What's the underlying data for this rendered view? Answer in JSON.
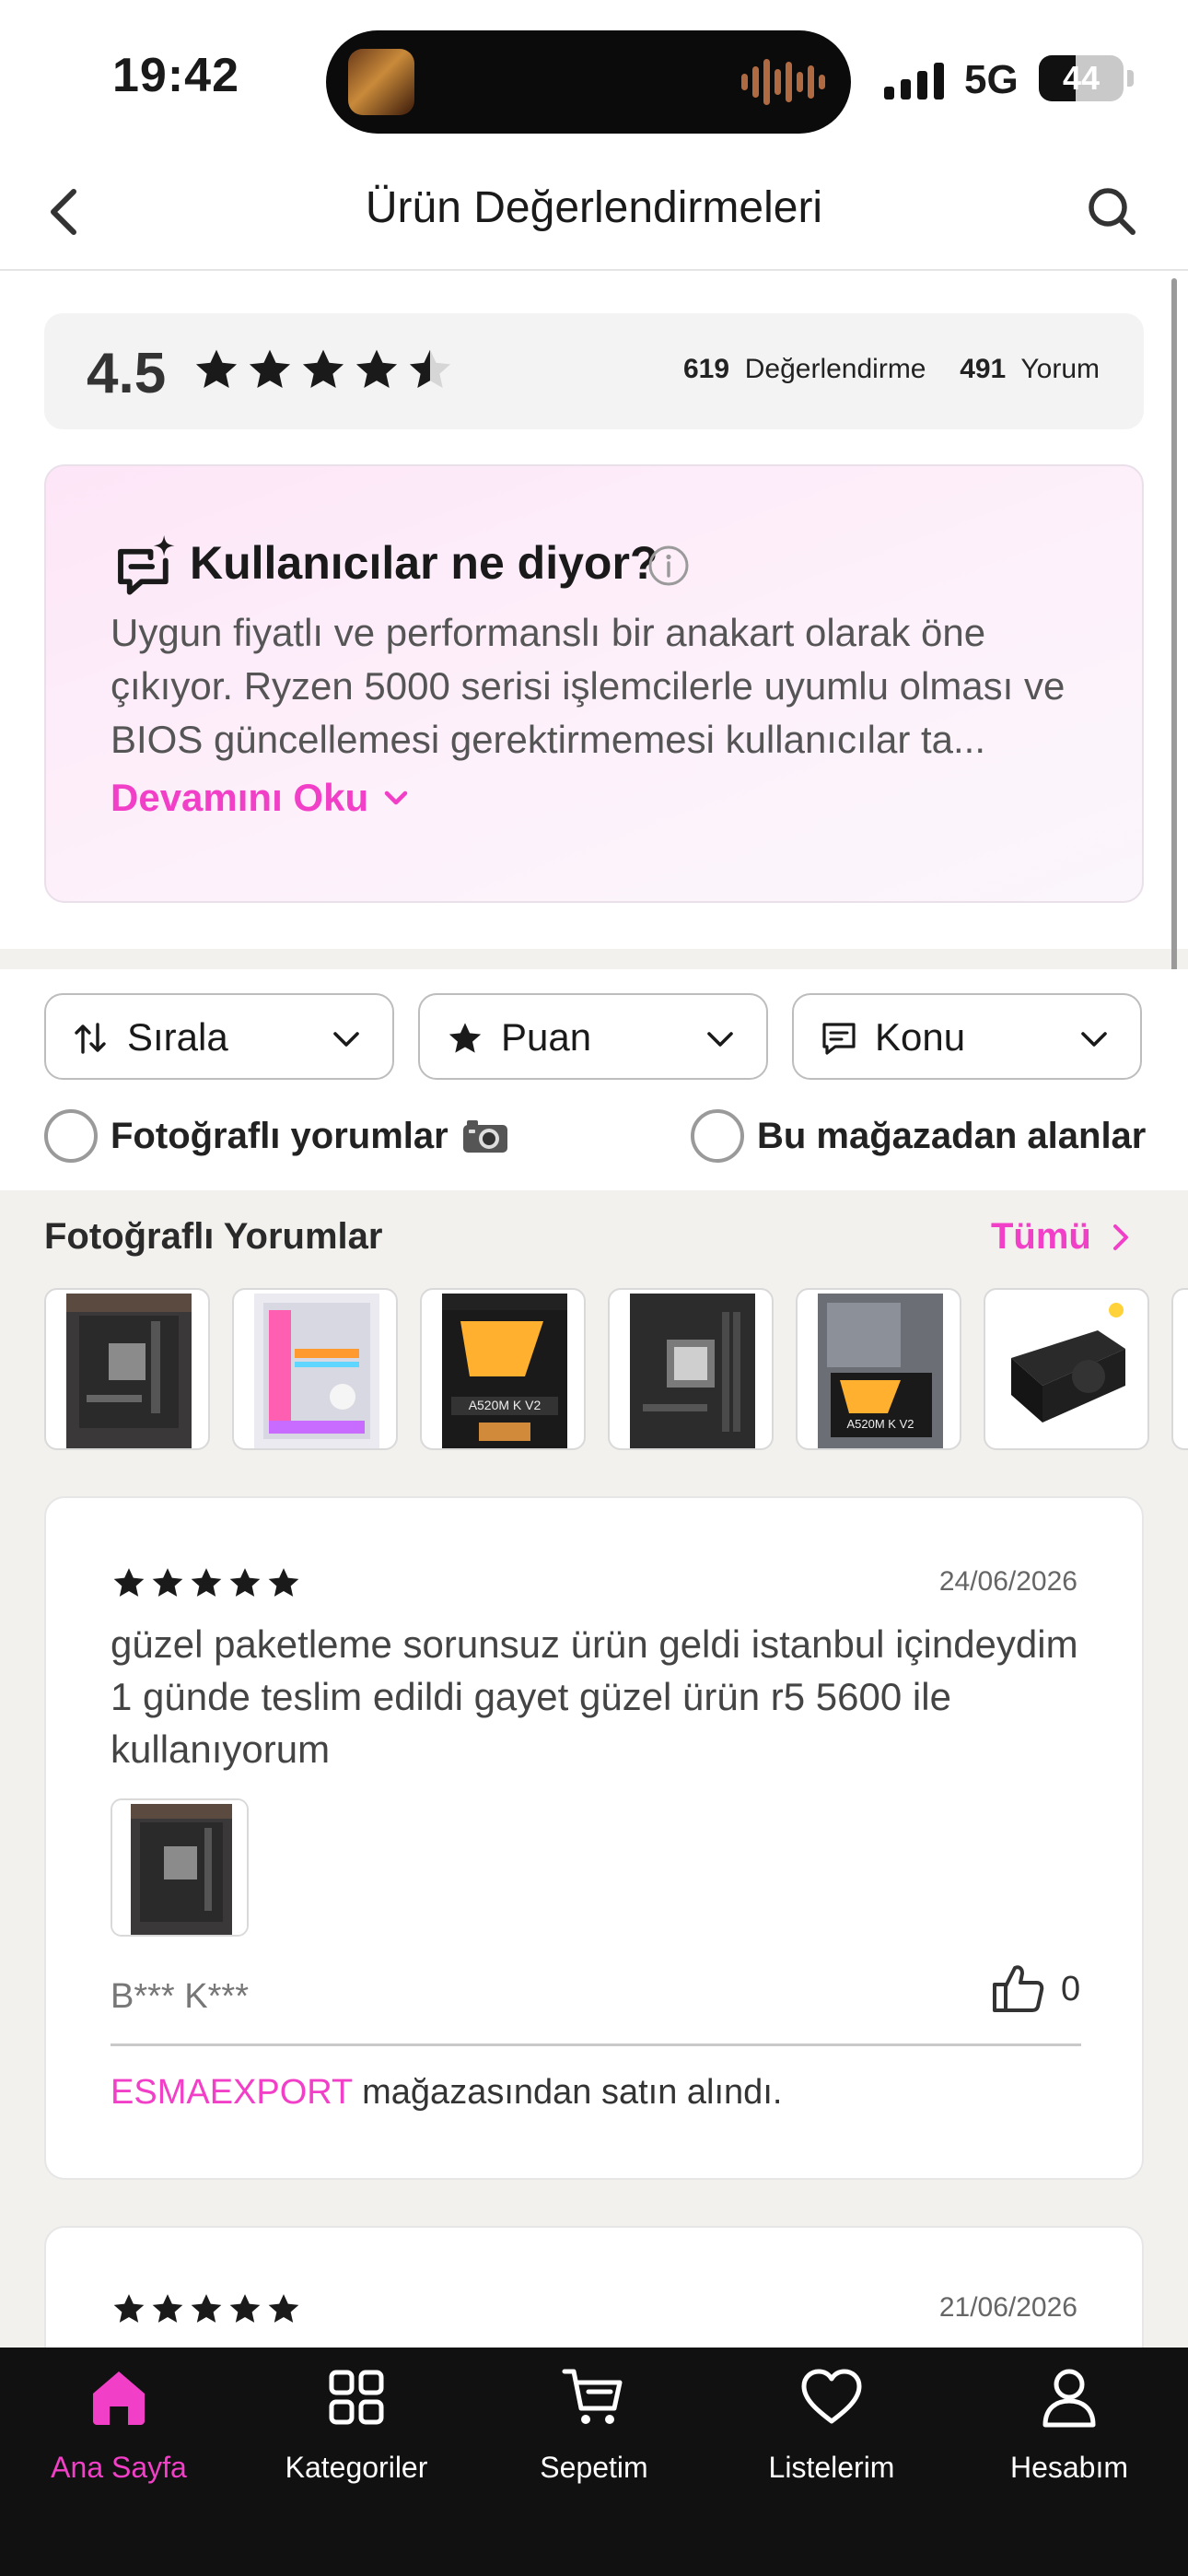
{
  "status_bar": {
    "time": "19:42",
    "network": "5G",
    "battery": "44",
    "battery_level": 0.44
  },
  "header": {
    "title": "Ürün Değerlendirmeleri"
  },
  "rating": {
    "value": "4.5",
    "stars": 4.5,
    "review_count": "619",
    "review_label": "Değerlendirme",
    "comment_count": "491",
    "comment_label": "Yorum"
  },
  "ai_summary": {
    "title": "Kullanıcılar ne diyor?",
    "text": "Uygun fiyatlı ve performanslı bir anakart olarak öne çıkıyor. Ryzen 5000 serisi işlemcilerle uyumlu olması ve BIOS güncellemesi gerektirmemesi kullanıcılar ta...",
    "more_label": "Devamını Oku"
  },
  "filters": {
    "sort_label": "Sırala",
    "rating_label": "Puan",
    "topic_label": "Konu",
    "photo_reviews_label": "Fotoğraflı yorumlar",
    "photo_reviews_emoji": "📷",
    "this_store_label": "Bu mağazadan alanlar"
  },
  "photo_reviews": {
    "title": "Fotoğraflı Yorumlar",
    "all_label": "Tümü"
  },
  "reviews": [
    {
      "stars": 5,
      "date": "24/06/2026",
      "text": "güzel paketleme sorunsuz ürün geldi istanbul içindeydim 1 günde teslim edildi gayet güzel ürün r5 5600 ile kullanıyorum",
      "author": "B*** K***",
      "likes": "0",
      "store": "ESMAEXPORT",
      "store_suffix": " mağazasından satın alındı."
    },
    {
      "stars": 5,
      "date": "21/06/2026"
    }
  ],
  "bottom_nav": [
    {
      "label": "Ana Sayfa",
      "icon": "home-icon",
      "active": true
    },
    {
      "label": "Kategoriler",
      "icon": "grid-icon",
      "active": false
    },
    {
      "label": "Sepetim",
      "icon": "cart-icon",
      "active": false
    },
    {
      "label": "Listelerim",
      "icon": "heart-icon",
      "active": false
    },
    {
      "label": "Hesabım",
      "icon": "user-icon",
      "active": false
    }
  ],
  "colors": {
    "accent": "#f23fc7",
    "nav_bg": "#111111"
  }
}
